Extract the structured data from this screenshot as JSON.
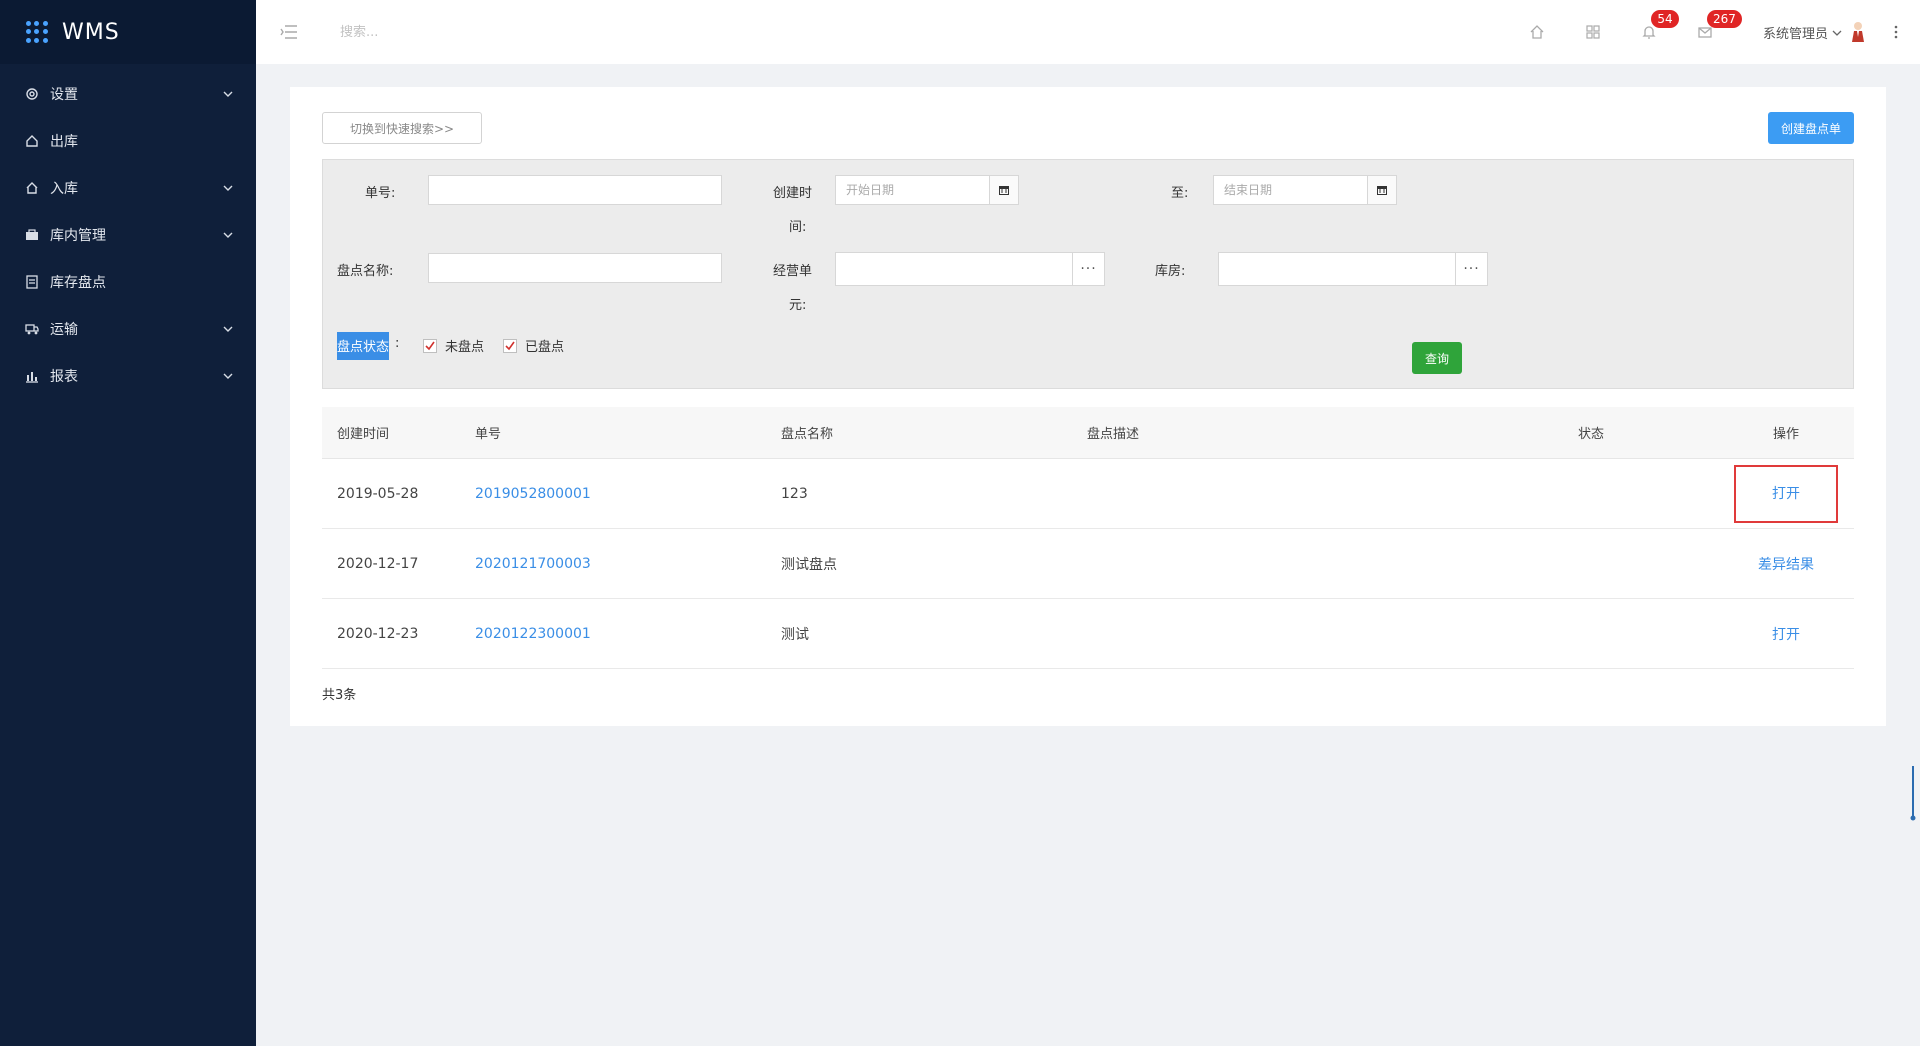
{
  "app": {
    "title": "WMS"
  },
  "sidebar": {
    "items": [
      {
        "label": "设置",
        "icon": "gear-icon",
        "has_children": true
      },
      {
        "label": "出库",
        "icon": "outbound-icon",
        "has_children": false
      },
      {
        "label": "入库",
        "icon": "inbound-icon",
        "has_children": true
      },
      {
        "label": "库内管理",
        "icon": "warehouse-icon",
        "has_children": true
      },
      {
        "label": "库存盘点",
        "icon": "inventory-icon",
        "has_children": false
      },
      {
        "label": "运输",
        "icon": "truck-icon",
        "has_children": true
      },
      {
        "label": "报表",
        "icon": "chart-icon",
        "has_children": true
      }
    ]
  },
  "header": {
    "search_placeholder": "搜索...",
    "notifications_count": "54",
    "messages_count": "267",
    "username": "系统管理员"
  },
  "toolbar": {
    "switch_search_label": "切换到快速搜索>>",
    "create_label": "创建盘点单"
  },
  "filter": {
    "order_no_label": "单号:",
    "created_time_label_1": "创建时",
    "created_time_label_2": "间:",
    "start_date_placeholder": "开始日期",
    "to_label": "至:",
    "end_date_placeholder": "结束日期",
    "inventory_name_label": "盘点名称:",
    "business_unit_label_1": "经营单",
    "business_unit_label_2": "元:",
    "warehouse_label": "库房:",
    "status_label": "盘点状态",
    "status_colon": ":",
    "status_options": [
      {
        "label": "未盘点",
        "checked": true
      },
      {
        "label": "已盘点",
        "checked": true
      }
    ],
    "query_label": "查询",
    "dots": "···"
  },
  "table": {
    "columns": [
      "创建时间",
      "单号",
      "盘点名称",
      "盘点描述",
      "状态",
      "操作"
    ],
    "rows": [
      {
        "created": "2019-05-28",
        "order_no": "2019052800001",
        "name": "123",
        "desc": "",
        "status": "",
        "action": "打开"
      },
      {
        "created": "2020-12-17",
        "order_no": "2020121700003",
        "name": "测试盘点",
        "desc": "",
        "status": "",
        "action": "差异结果"
      },
      {
        "created": "2020-12-23",
        "order_no": "2020122300001",
        "name": "测试",
        "desc": "",
        "status": "",
        "action": "打开"
      }
    ],
    "total_text": "共3条"
  },
  "colors": {
    "sidebar_bg": "#0f1f3a",
    "primary": "#3c9cf3",
    "success": "#2fa43a",
    "badge": "#e02525",
    "highlight_border": "#e03a3a"
  }
}
